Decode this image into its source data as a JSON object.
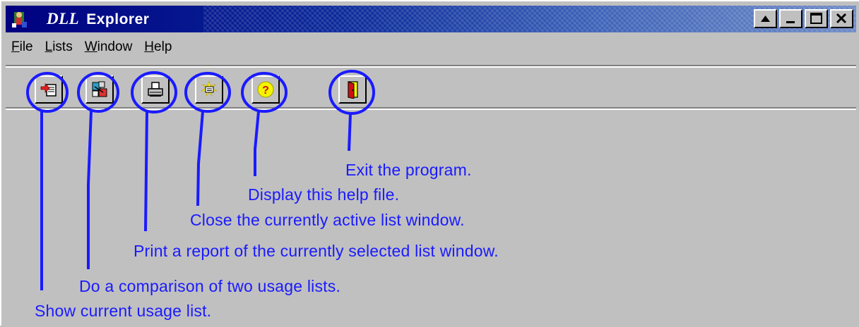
{
  "window": {
    "title_prefix": "DLL",
    "title": "Explorer",
    "controls": [
      {
        "name": "restore-button",
        "icon": "caret-up-icon"
      },
      {
        "name": "minimize-button",
        "icon": "minimize-icon"
      },
      {
        "name": "maximize-button",
        "icon": "maximize-icon"
      },
      {
        "name": "close-button",
        "icon": "close-x-icon"
      }
    ]
  },
  "menu": {
    "items": [
      {
        "underline": "F",
        "rest": "ile"
      },
      {
        "underline": "L",
        "rest": "ists"
      },
      {
        "underline": "W",
        "rest": "indow"
      },
      {
        "underline": "H",
        "rest": "elp"
      }
    ]
  },
  "toolbar": {
    "buttons": [
      {
        "icon": "show-list-icon"
      },
      {
        "icon": "compare-lists-icon"
      },
      {
        "icon": "print-icon"
      },
      {
        "icon": "close-window-icon"
      },
      {
        "icon": "help-icon"
      },
      {
        "icon": "exit-door-icon"
      }
    ]
  },
  "annotations": {
    "color": "#1a1aff",
    "labels": [
      "Show current usage list.",
      "Do a comparison of two usage lists.",
      "Print a report of the currently selected list window.",
      "Close the currently active list window.",
      "Display this help file.",
      "Exit the program."
    ]
  },
  "colors": {
    "face": "#c0c0c0",
    "titlebar": "#000080",
    "annotation": "#1a1aff"
  }
}
